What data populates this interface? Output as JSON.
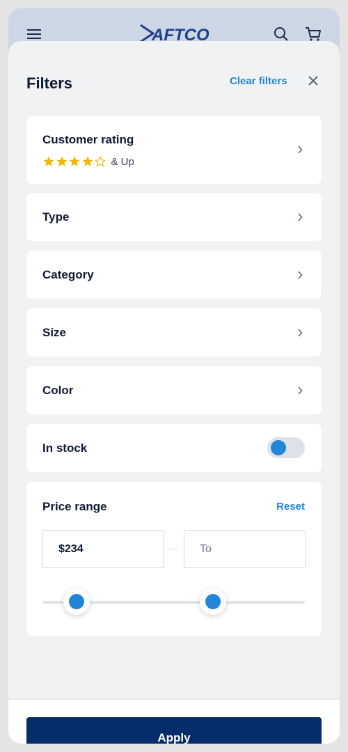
{
  "header": {
    "logo_text": "AFTCO",
    "icons": [
      "menu-icon",
      "search-icon",
      "cart-icon"
    ]
  },
  "filters": {
    "title": "Filters",
    "clear_label": "Clear filters",
    "close_icon": "close-icon"
  },
  "rating": {
    "label": "Customer rating",
    "stars_filled": 4,
    "stars_total": 5,
    "suffix": "& Up"
  },
  "rows": {
    "type": "Type",
    "category": "Category",
    "size": "Size",
    "color": "Color"
  },
  "stock": {
    "label": "In stock",
    "toggle_on": false
  },
  "price": {
    "label": "Price range",
    "reset_label": "Reset",
    "from_value": "$234",
    "to_placeholder": "To",
    "slider_min_fraction": 0.13,
    "slider_max_fraction": 0.65
  },
  "footer": {
    "apply_label": "Apply"
  },
  "colors": {
    "accent": "#2286d8",
    "primary_button": "#062d6b",
    "star": "#f2b705"
  }
}
